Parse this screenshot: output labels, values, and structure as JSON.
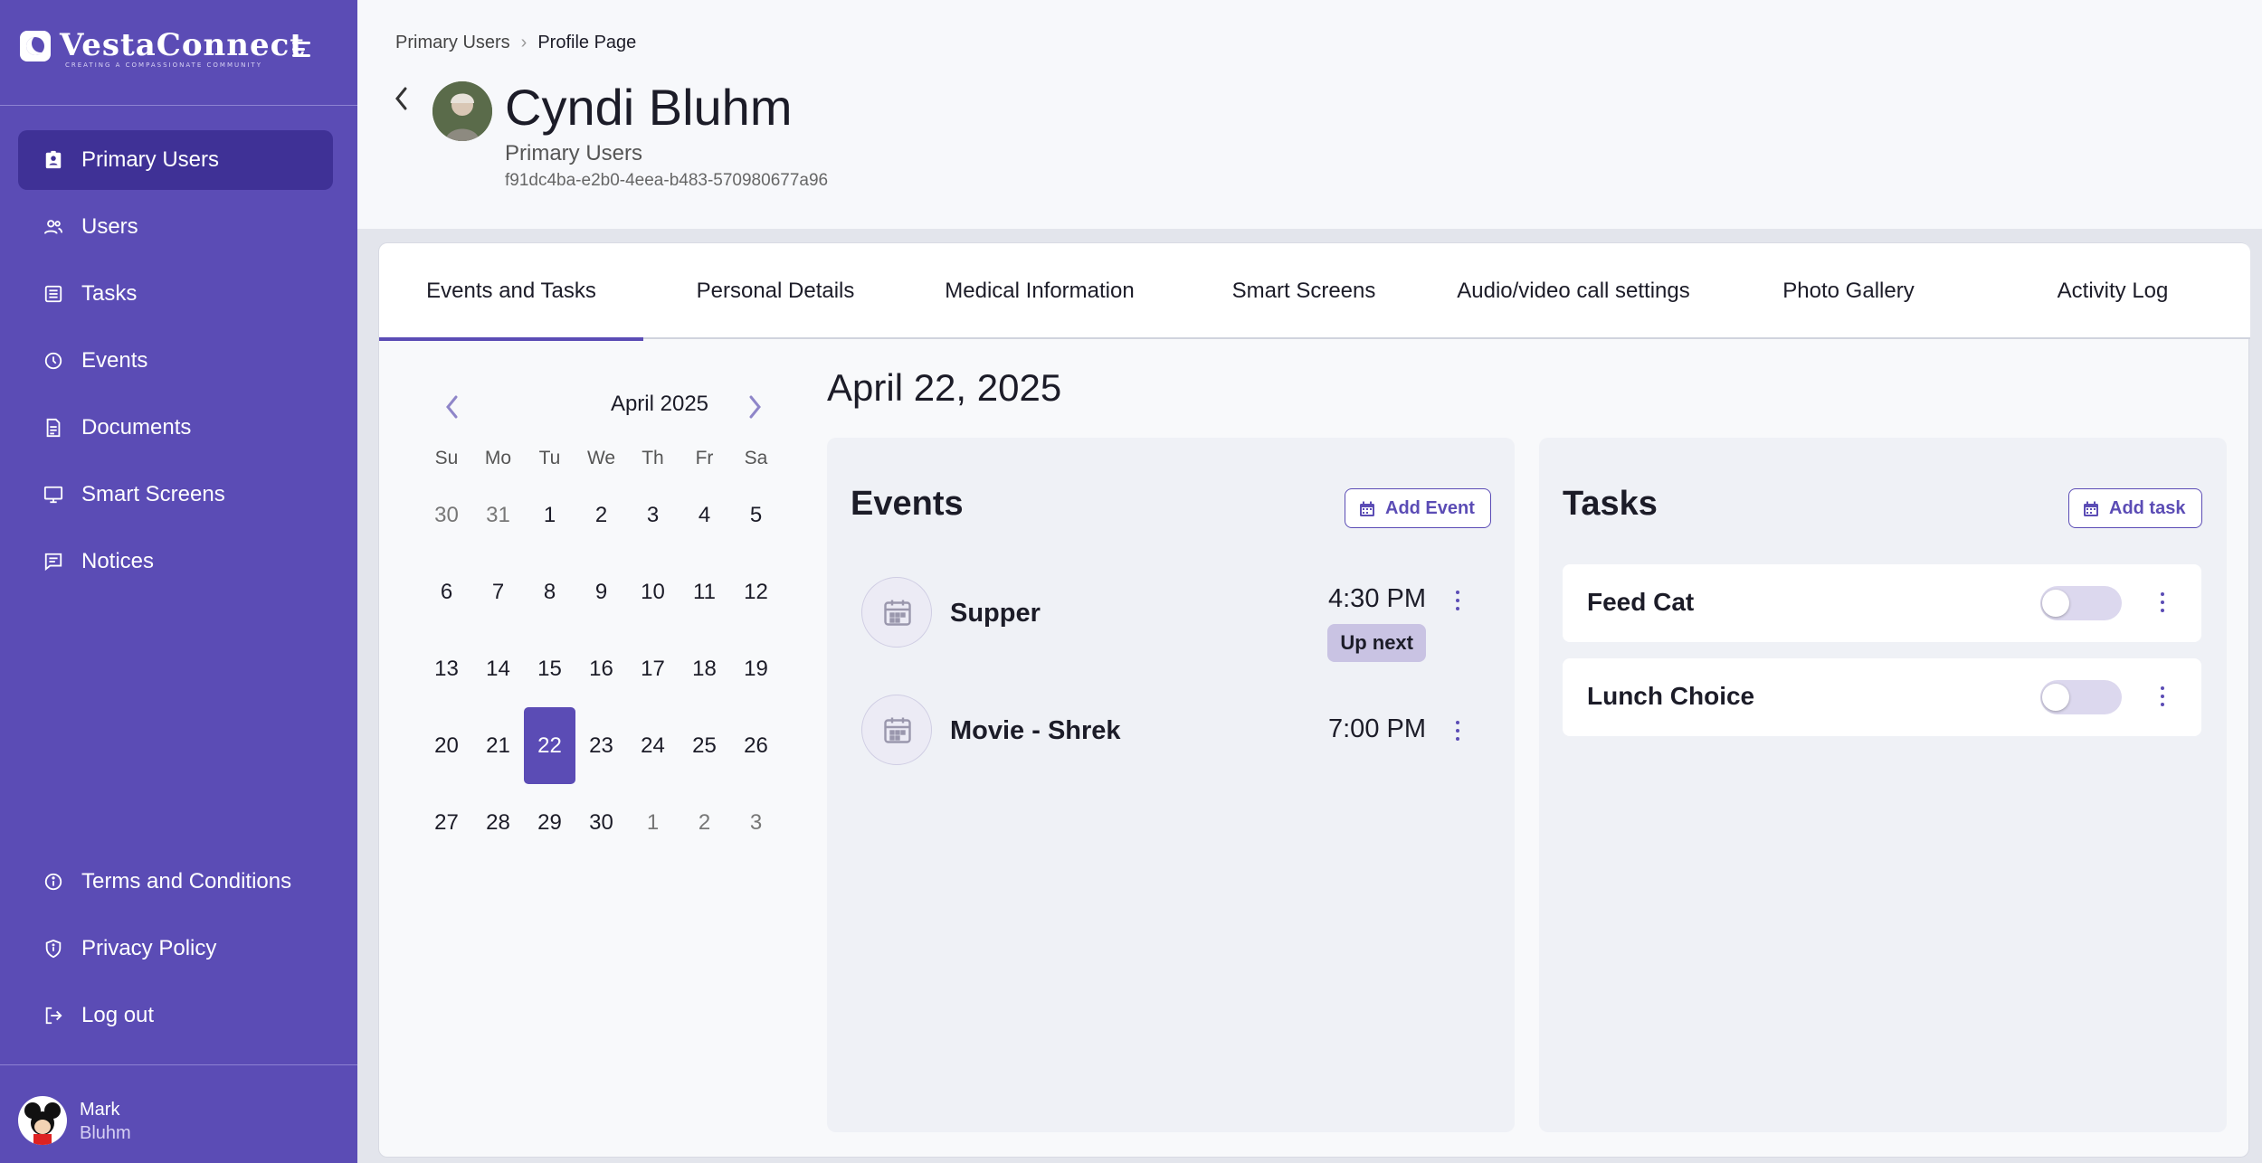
{
  "colors": {
    "sidebar": "#5b4cb5",
    "sidebar_active": "#3f3196",
    "accent": "#5b4cb5",
    "upnext_badge": "#c9c3e3"
  },
  "app": {
    "name": "VestaConnect",
    "tagline": "CREATING A COMPASSIONATE COMMUNITY"
  },
  "sidebar": {
    "items": [
      {
        "label": "Primary Users",
        "icon": "badge-icon",
        "active": true
      },
      {
        "label": "Users",
        "icon": "users-icon"
      },
      {
        "label": "Tasks",
        "icon": "tasks-icon"
      },
      {
        "label": "Events",
        "icon": "clock-icon"
      },
      {
        "label": "Documents",
        "icon": "document-icon"
      },
      {
        "label": "Smart Screens",
        "icon": "monitor-icon"
      },
      {
        "label": "Notices",
        "icon": "notice-icon"
      }
    ],
    "footer_items": [
      {
        "label": "Terms and Conditions",
        "icon": "info-icon"
      },
      {
        "label": "Privacy Policy",
        "icon": "shield-icon"
      },
      {
        "label": "Log out",
        "icon": "logout-icon"
      }
    ],
    "user": {
      "first": "Mark",
      "last": "Bluhm"
    }
  },
  "breadcrumb": {
    "parent": "Primary Users",
    "current": "Profile Page"
  },
  "profile": {
    "name": "Cyndi Bluhm",
    "role": "Primary Users",
    "id": "f91dc4ba-e2b0-4eea-b483-570980677a96"
  },
  "tabs": [
    {
      "label": "Events and Tasks",
      "active": true
    },
    {
      "label": "Personal Details"
    },
    {
      "label": "Medical Information"
    },
    {
      "label": "Smart Screens"
    },
    {
      "label": "Audio/video call settings"
    },
    {
      "label": "Photo Gallery"
    },
    {
      "label": "Activity Log"
    }
  ],
  "calendar": {
    "month": "April 2025",
    "days_of_week": [
      "Su",
      "Mo",
      "Tu",
      "We",
      "Th",
      "Fr",
      "Sa"
    ],
    "weeks": [
      [
        "30",
        "31",
        "1",
        "2",
        "3",
        "4",
        "5"
      ],
      [
        "6",
        "7",
        "8",
        "9",
        "10",
        "11",
        "12"
      ],
      [
        "13",
        "14",
        "15",
        "16",
        "17",
        "18",
        "19"
      ],
      [
        "20",
        "21",
        "22",
        "23",
        "24",
        "25",
        "26"
      ],
      [
        "27",
        "28",
        "29",
        "30",
        "1",
        "2",
        "3"
      ]
    ],
    "selected": "22"
  },
  "selected_date": "April 22, 2025",
  "events": {
    "title": "Events",
    "add_label": "Add Event",
    "items": [
      {
        "name": "Supper",
        "time": "4:30 PM",
        "badge": "Up next"
      },
      {
        "name": "Movie - Shrek",
        "time": "7:00 PM"
      }
    ]
  },
  "tasks": {
    "title": "Tasks",
    "add_label": "Add task",
    "items": [
      {
        "name": "Feed Cat",
        "done": false
      },
      {
        "name": "Lunch Choice",
        "done": false
      }
    ]
  }
}
